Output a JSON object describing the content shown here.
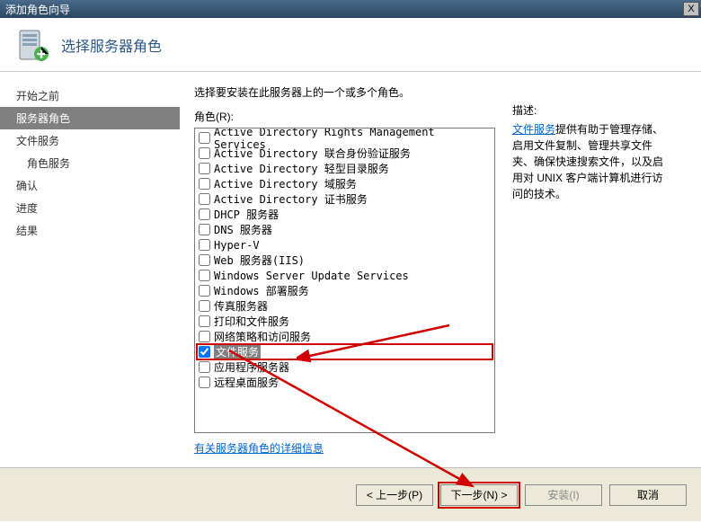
{
  "titlebar": {
    "title": "添加角色向导",
    "close": "X"
  },
  "header": {
    "title": "选择服务器角色"
  },
  "sidebar": {
    "items": [
      {
        "label": "开始之前",
        "active": false,
        "indent": false
      },
      {
        "label": "服务器角色",
        "active": true,
        "indent": false
      },
      {
        "label": "文件服务",
        "active": false,
        "indent": false
      },
      {
        "label": "角色服务",
        "active": false,
        "indent": true
      },
      {
        "label": "确认",
        "active": false,
        "indent": false
      },
      {
        "label": "进度",
        "active": false,
        "indent": false
      },
      {
        "label": "结果",
        "active": false,
        "indent": false
      }
    ]
  },
  "main": {
    "instruction": "选择要安装在此服务器上的一个或多个角色。",
    "roles_label": "角色(R):",
    "roles": [
      {
        "label": "Active Directory Rights Management Services",
        "checked": false
      },
      {
        "label": "Active Directory 联合身份验证服务",
        "checked": false
      },
      {
        "label": "Active Directory 轻型目录服务",
        "checked": false
      },
      {
        "label": "Active Directory 域服务",
        "checked": false
      },
      {
        "label": "Active Directory 证书服务",
        "checked": false
      },
      {
        "label": "DHCP 服务器",
        "checked": false
      },
      {
        "label": "DNS 服务器",
        "checked": false
      },
      {
        "label": "Hyper-V",
        "checked": false
      },
      {
        "label": "Web 服务器(IIS)",
        "checked": false
      },
      {
        "label": "Windows Server Update Services",
        "checked": false
      },
      {
        "label": "Windows 部署服务",
        "checked": false
      },
      {
        "label": "传真服务器",
        "checked": false
      },
      {
        "label": "打印和文件服务",
        "checked": false
      },
      {
        "label": "网络策略和访问服务",
        "checked": false
      },
      {
        "label": "文件服务",
        "checked": true,
        "highlight": true
      },
      {
        "label": "应用程序服务器",
        "checked": false
      },
      {
        "label": "远程桌面服务",
        "checked": false
      }
    ],
    "more_link": "有关服务器角色的详细信息"
  },
  "desc": {
    "title": "描述:",
    "link": "文件服务",
    "text": "提供有助于管理存储、启用文件复制、管理共享文件夹、确保快速搜索文件，以及启用对 UNIX 客户端计算机进行访问的技术。"
  },
  "footer": {
    "prev": "< 上一步(P)",
    "next": "下一步(N) >",
    "install": "安装(I)",
    "cancel": "取消"
  }
}
